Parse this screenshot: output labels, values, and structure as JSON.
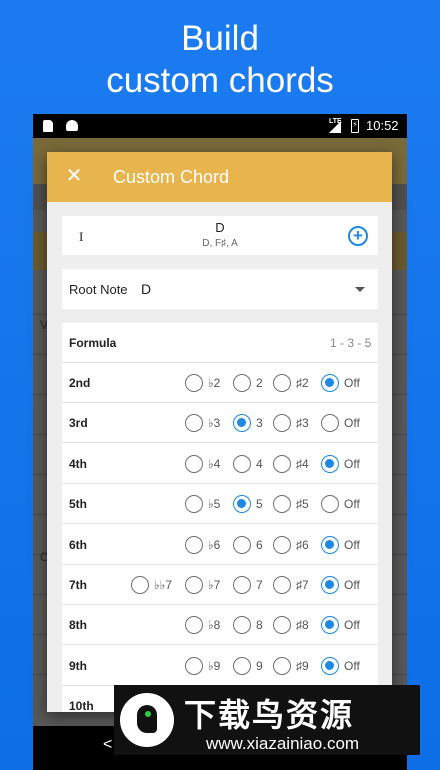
{
  "promo": {
    "line1": "Build",
    "line2": "custom chords"
  },
  "status_bar": {
    "network": "LTE",
    "time": "10:52"
  },
  "background_app": {
    "letters": [
      "V",
      "C"
    ],
    "navbar_back": "<"
  },
  "dialog": {
    "title": "Custom Chord",
    "chord": {
      "numeral": "I",
      "name": "D",
      "notes": "D, F♯, A"
    },
    "root_note": {
      "label": "Root Note",
      "value": "D"
    },
    "formula": {
      "label": "Formula",
      "value": "1 - 3 - 5"
    },
    "rows": [
      {
        "label": "2nd",
        "options": [
          "♭2",
          "2",
          "♯2",
          "Off"
        ],
        "selected": 3
      },
      {
        "label": "3rd",
        "options": [
          "♭3",
          "3",
          "♯3",
          "Off"
        ],
        "selected": 1
      },
      {
        "label": "4th",
        "options": [
          "♭4",
          "4",
          "♯4",
          "Off"
        ],
        "selected": 3
      },
      {
        "label": "5th",
        "options": [
          "♭5",
          "5",
          "♯5",
          "Off"
        ],
        "selected": 1
      },
      {
        "label": "6th",
        "options": [
          "♭6",
          "6",
          "♯6",
          "Off"
        ],
        "selected": 3
      },
      {
        "label": "7th",
        "options": [
          "♭♭7",
          "♭7",
          "7",
          "♯7",
          "Off"
        ],
        "selected": 4
      },
      {
        "label": "8th",
        "options": [
          "♭8",
          "8",
          "♯8",
          "Off"
        ],
        "selected": 3
      },
      {
        "label": "9th",
        "options": [
          "♭9",
          "9",
          "♯9",
          "Off"
        ],
        "selected": 3
      },
      {
        "label": "10th",
        "options": [],
        "selected": -1
      }
    ]
  },
  "watermark": {
    "title": "下载鸟资源",
    "url": "www.xiazainiao.com"
  },
  "colors": {
    "header": "#e7b44e",
    "accent": "#1e88e5",
    "promo_bg": "#1c7bf0"
  }
}
